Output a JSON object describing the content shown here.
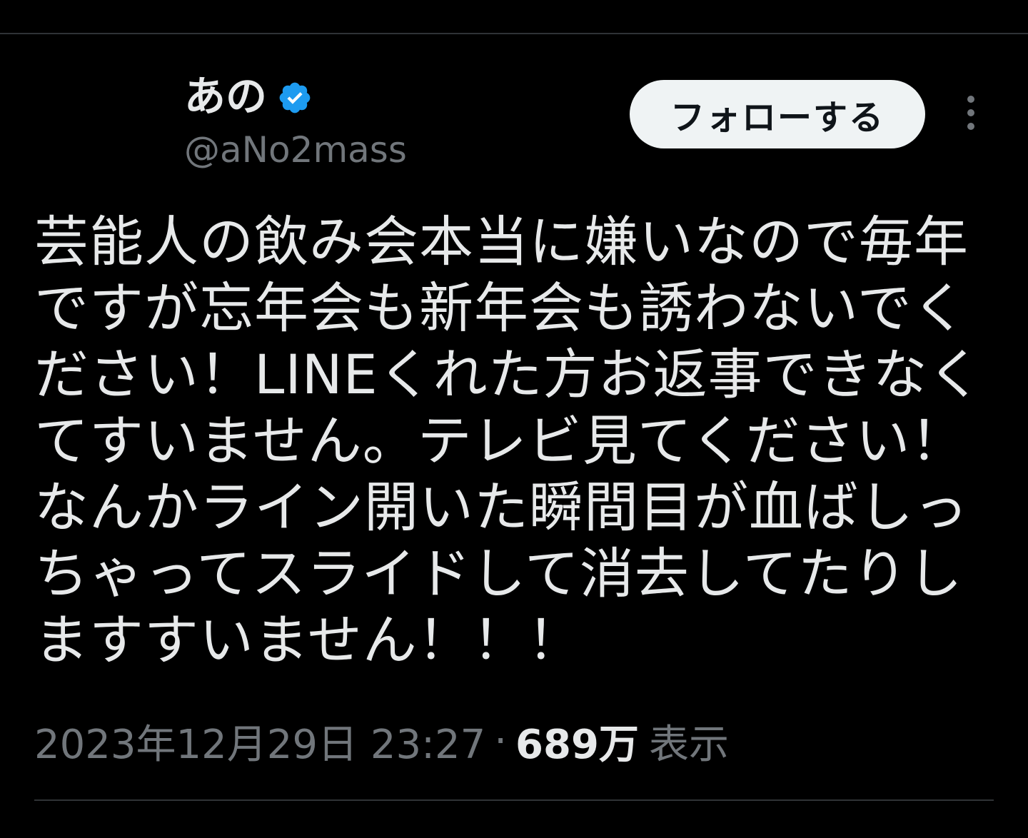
{
  "user": {
    "display_name": "あの",
    "verified": true,
    "handle": "@aNo2mass"
  },
  "actions": {
    "follow_label": "フォローする",
    "more_icon": "more-vertical-icon"
  },
  "tweet": {
    "text": "芸能人の飲み会本当に嫌いなので毎年ですが忘年会も新年会も誘わないでください！LINEくれた方お返事できなくてすいません。テレビ見てください！なんかライン開いた瞬間目が血ばしっちゃってスライドして消去してたりしますすいません！！！"
  },
  "meta": {
    "timestamp": "2023年12月29日 23:27",
    "separator": "·",
    "views_count": "689万",
    "views_label": "表示"
  },
  "colors": {
    "background": "#000000",
    "text_primary": "#e7e9ea",
    "text_secondary": "#71767b",
    "verified_blue": "#1d9bf0",
    "button_bg": "#eff3f4",
    "divider": "#2f3336"
  }
}
